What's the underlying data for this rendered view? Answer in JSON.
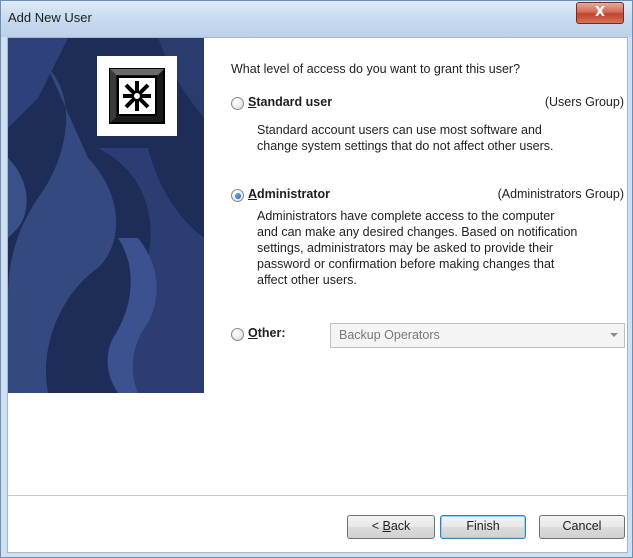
{
  "window": {
    "title": "Add New User",
    "close_glyph": "X"
  },
  "question": "What level of access do you want to grant this user?",
  "options": {
    "standard": {
      "label_accel": "S",
      "label_rest": "tandard user",
      "group": "(Users Group)",
      "description": [
        "Standard account users can use most software and",
        "change system settings that do not affect other users."
      ],
      "checked": false
    },
    "administrator": {
      "label_accel": "A",
      "label_rest": "dministrator",
      "group": "(Administrators Group)",
      "description": [
        "Administrators have complete access to the computer",
        "and can make any desired changes. Based on notification",
        "settings, administrators may be asked to provide their",
        "password or confirmation before making changes that",
        "affect other users."
      ],
      "checked": true
    },
    "other": {
      "label_accel": "O",
      "label_rest": "ther:",
      "selected_value": "Backup Operators",
      "checked": false
    }
  },
  "buttons": {
    "back_prefix": "< ",
    "back_accel": "B",
    "back_rest": "ack",
    "finish": "Finish",
    "cancel": "Cancel"
  },
  "colors": {
    "sidebar_bg": "#1e2c58",
    "close_btn": "#c0432c",
    "accent": "#1f5aa8"
  },
  "icons": {
    "logo": "user-accounts-logo-icon",
    "radio": "radio-icon",
    "dropdown": "chevron-down-icon"
  }
}
